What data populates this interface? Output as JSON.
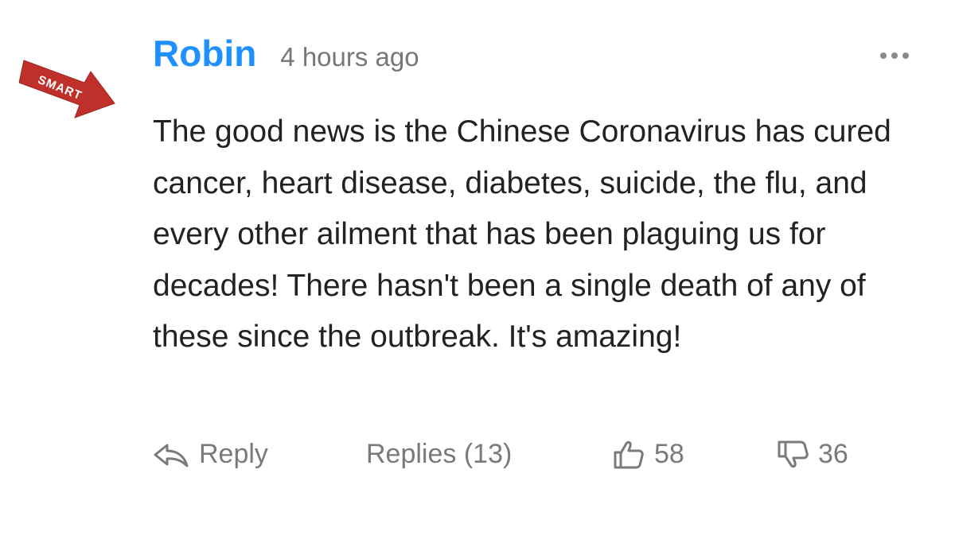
{
  "badge": {
    "text": "SMART",
    "color": "#c0302b"
  },
  "comment": {
    "author": "Robin",
    "timestamp": "4 hours ago",
    "body": "The good news is the Chinese Coronavirus has cured cancer, heart disease, diabetes, suicide, the flu, and every other ailment that has been plaguing us for decades! There hasn't been a single death of any of these since the outbreak. It's amazing!",
    "more_icon": "more-horizontal-icon"
  },
  "actions": {
    "reply_label": "Reply",
    "reply_icon": "reply-arrow-icon",
    "replies_label": "Replies (13)",
    "likes": "58",
    "like_icon": "thumbs-up-icon",
    "dislikes": "36",
    "dislike_icon": "thumbs-down-icon"
  },
  "colors": {
    "author": "#1e90ff",
    "meta": "#777777",
    "text": "#222222"
  }
}
